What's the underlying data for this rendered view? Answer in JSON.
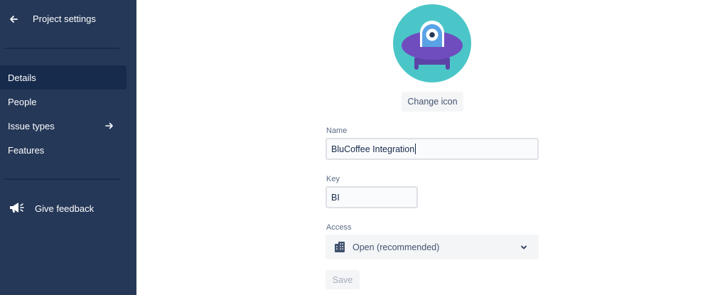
{
  "sidebar": {
    "back_label": "Project settings",
    "items": [
      {
        "label": "Details",
        "active": true
      },
      {
        "label": "People"
      },
      {
        "label": "Issue types",
        "icon": "arrow-right-icon"
      },
      {
        "label": "Features"
      }
    ],
    "feedback_label": "Give feedback",
    "feedback_icon": "megaphone-icon"
  },
  "main": {
    "avatar_icon": "ufo-avatar-icon",
    "change_icon_label": "Change icon",
    "name_label": "Name",
    "name_value": "BluCoffee Integration",
    "key_label": "Key",
    "key_value": "BI",
    "access_label": "Access",
    "access_value": "Open (recommended)",
    "access_icon": "building-icon",
    "save_label": "Save"
  },
  "colors": {
    "sidebar_bg": "#253858",
    "sidebar_active": "#172b4d",
    "avatar_bg": "#4bc6c8",
    "avatar_purple": "#6f4dbf",
    "disabled_text": "#a5adba"
  }
}
